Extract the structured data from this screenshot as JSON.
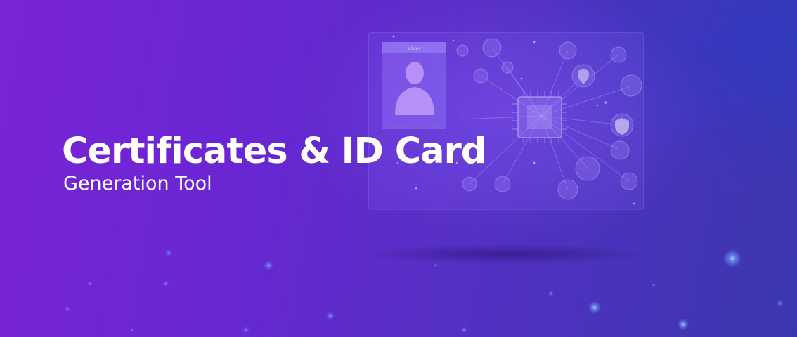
{
  "banner": {
    "title": "Certificates & ID Card",
    "subtitle": "Generation Tool"
  },
  "id_card": {
    "header_label": "w3dev"
  },
  "colors": {
    "background_start": "#7a24d6",
    "background_end": "#3a37ad",
    "title": "#ffffff",
    "glow": "#7fb2ff"
  },
  "icons": [
    "person-avatar-icon",
    "circuit-chip-icon",
    "shield-lock-icon",
    "location-pin-icon",
    "bank-icon",
    "id-badge-icon",
    "credit-card-icon",
    "key-icon",
    "wifi-icon",
    "chat-icon"
  ]
}
